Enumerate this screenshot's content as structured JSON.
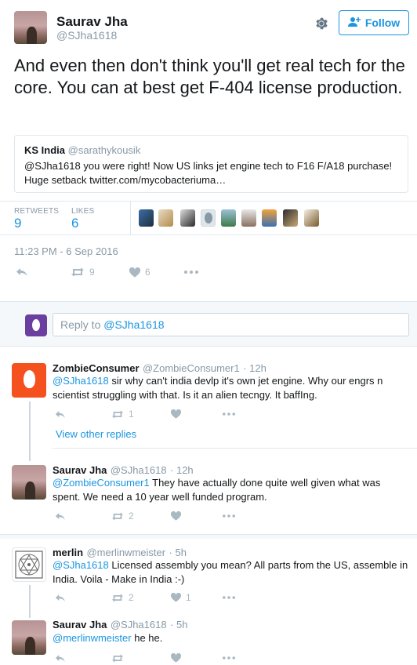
{
  "tweet": {
    "author_name": "Saurav Jha",
    "author_handle": "@SJha1618",
    "follow_label": "Follow",
    "text": "And even then don't think you'll get real tech for the core. You can at best get F-404 license production.",
    "quote": {
      "name": "KS India",
      "handle": "@sarathykousik",
      "text_handle": "@SJha1618",
      "text": " you were right! Now US links jet engine tech to F16 F/A18 purchase! Huge setback twitter.com/mycobacteriuma…"
    },
    "stats": {
      "retweets_label": "RETWEETS",
      "retweets": "9",
      "likes_label": "LIKES",
      "likes": "6"
    },
    "timestamp": "11:23 PM - 6 Sep 2016",
    "actions": {
      "retweets": "9",
      "likes": "6"
    }
  },
  "reply_box": {
    "placeholder_prefix": "Reply to ",
    "placeholder_handle": "@SJha1618"
  },
  "replies": [
    {
      "name": "ZombieConsumer",
      "handle": "@ZombieConsumer1",
      "time": "· 12h",
      "mention": "@SJha1618",
      "text": " sir why can't india devlp it's own jet engine. Why our engrs n scientist struggling with that. Is it an alien tecngy. It baffIng.",
      "retweets": "1",
      "likes": ""
    },
    {
      "view_other_replies": "View other replies"
    },
    {
      "name": "Saurav Jha",
      "handle": "@SJha1618",
      "time": "· 12h",
      "mention": "@ZombieConsumer1",
      "text": " They have actually done quite well given what was spent. We need a 10 year well funded program.",
      "retweets": "2",
      "likes": ""
    },
    {
      "name": "merlin",
      "handle": "@merlinwmeister",
      "time": "· 5h",
      "mention": "@SJha1618",
      "text": " Licensed assembly you mean? All parts from the US, assemble in India. Voila - Make in India :-)",
      "retweets": "2",
      "likes": "1"
    },
    {
      "name": "Saurav Jha",
      "handle": "@SJha1618",
      "time": "· 5h",
      "mention": "@merlinwmeister",
      "text": " he he.",
      "retweets": "",
      "likes": ""
    }
  ],
  "colors": {
    "accent": "#1b95e0",
    "muted": "#8899a6",
    "icon": "#aab8c2",
    "border": "#e1e8ed",
    "zombie_avatar": "#f4511e",
    "reply_avatar": "#6b3fa0"
  }
}
